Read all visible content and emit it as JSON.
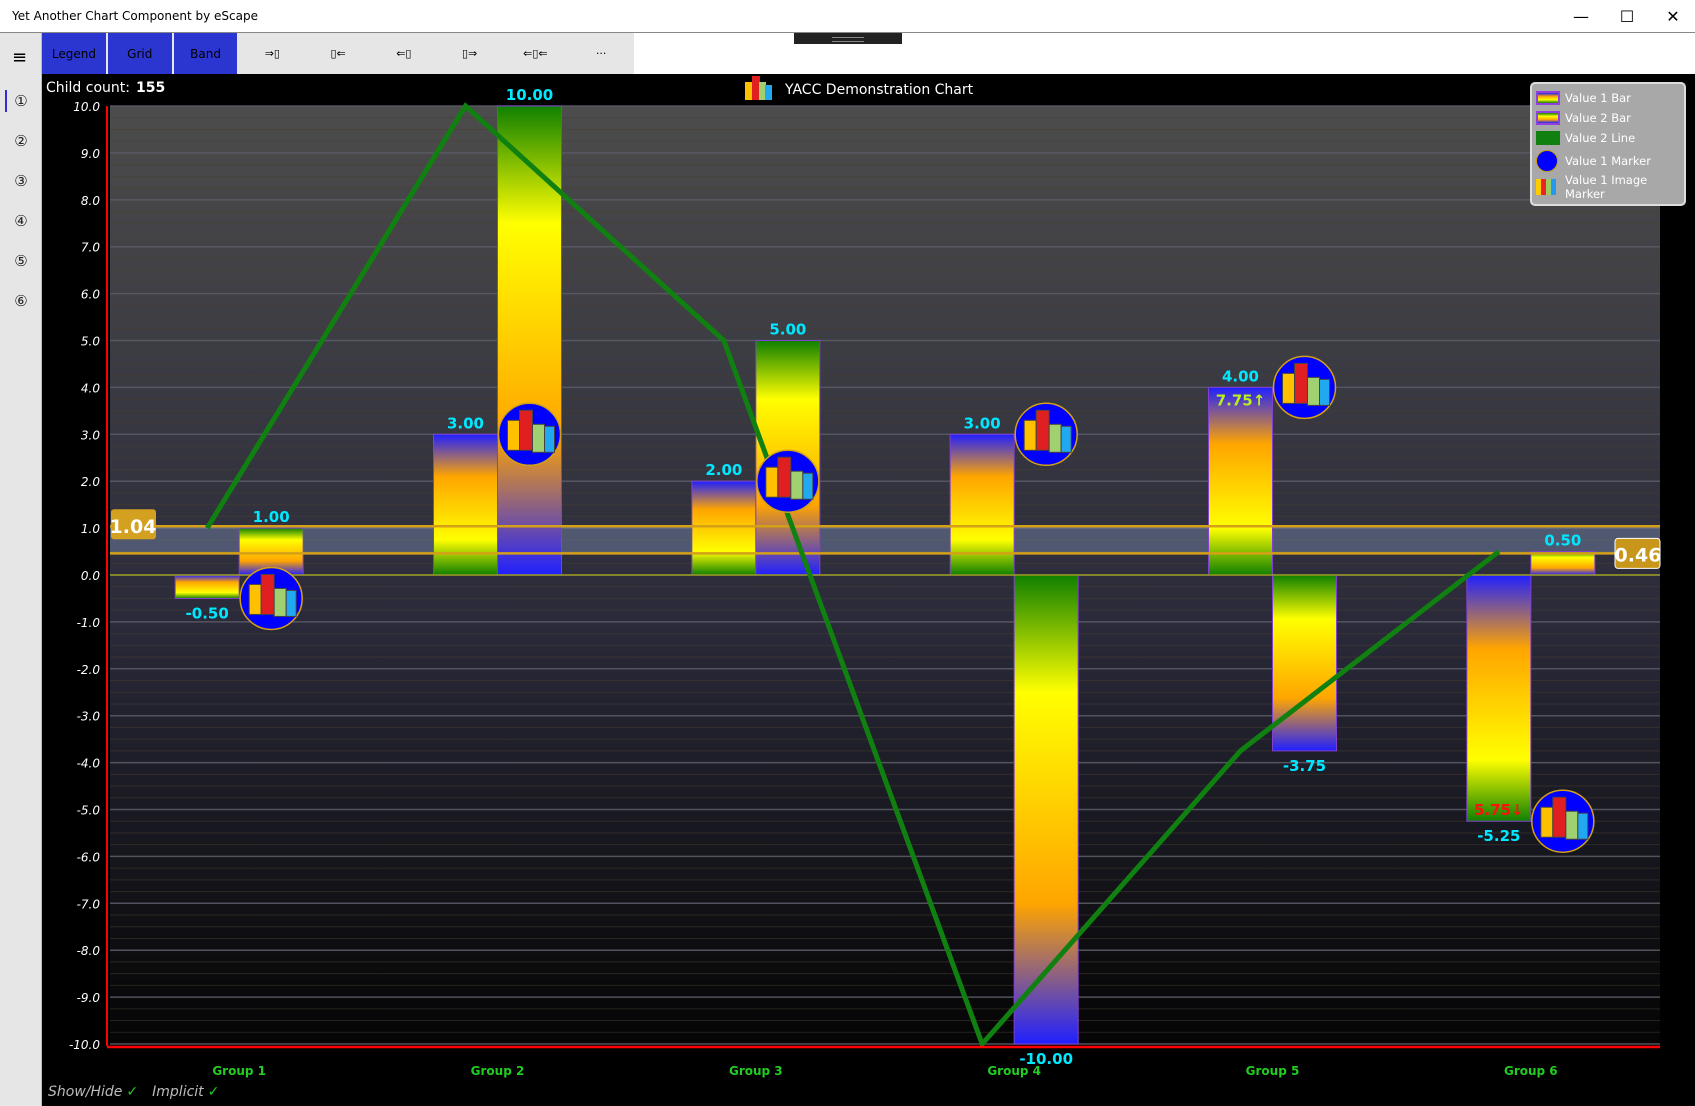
{
  "window": {
    "title": "Yet Another Chart Component by eScape",
    "minimize": "—",
    "maximize": "☐",
    "close": "✕"
  },
  "nav": {
    "menu_icon": "≡",
    "items": [
      "①",
      "②",
      "③",
      "④",
      "⑤",
      "⑥"
    ],
    "selected": 0
  },
  "toolbar": {
    "buttons": [
      {
        "label": "Legend",
        "active": true
      },
      {
        "label": "Grid",
        "active": true
      },
      {
        "label": "Band",
        "active": true
      },
      {
        "label": "⇒▯",
        "active": false
      },
      {
        "label": "▯⇐",
        "active": false
      },
      {
        "label": "⇐▯",
        "active": false
      },
      {
        "label": "▯⇒",
        "active": false
      },
      {
        "label": "⇐▯⇐",
        "active": false
      },
      {
        "label": "···",
        "active": false
      }
    ]
  },
  "status": {
    "child_count_label": "Child count:",
    "child_count": "155"
  },
  "footer": {
    "show_hide": "Show/Hide",
    "implicit": "Implicit",
    "check": "✓"
  },
  "legend": [
    {
      "label": "Value 1 Bar",
      "type": "bar1"
    },
    {
      "label": "Value 2 Bar",
      "type": "bar2"
    },
    {
      "label": "Value 2 Line",
      "type": "line"
    },
    {
      "label": "Value 1 Marker",
      "type": "marker"
    },
    {
      "label": "Value 1 Image Marker",
      "type": "image"
    }
  ],
  "colors": {
    "line": "#108010",
    "label": "#00e8ff",
    "band": "#d4a017",
    "axis": "#ff0000",
    "group_label": "#22cc22",
    "up_label": "#b8f020",
    "down_label": "#ff1010"
  },
  "chart_data": {
    "type": "bar",
    "title": "YACC Demonstration Chart",
    "categories": [
      "Group 1",
      "Group 2",
      "Group 3",
      "Group 4",
      "Group 5",
      "Group 6"
    ],
    "series": [
      {
        "name": "Value 1 Bar",
        "values": [
          -0.5,
          3,
          2,
          3,
          4,
          -5.25
        ],
        "labels": [
          "-0.50",
          "3.00",
          "2.00",
          "3.00",
          "4.00",
          "-5.25"
        ]
      },
      {
        "name": "Value 2 Bar",
        "values": [
          1,
          10,
          5,
          -10,
          -3.75,
          0.5
        ],
        "labels": [
          "1.00",
          "10.00",
          "5.00",
          "-10.00",
          "-3.75",
          "0.50"
        ]
      },
      {
        "name": "Value 2 Line",
        "type": "line",
        "values": [
          1,
          10,
          5,
          -10,
          -3.75,
          0.5
        ]
      },
      {
        "name": "Value 1 Image Marker",
        "type": "marker",
        "values": [
          -0.5,
          3,
          2,
          3,
          4,
          -5.25
        ]
      }
    ],
    "annotations": [
      {
        "group": 4,
        "text": "7.75↑",
        "kind": "up"
      },
      {
        "group": 5,
        "text": "5.75↓",
        "kind": "down"
      }
    ],
    "band": {
      "low": 0.46,
      "high": 1.04,
      "low_label": "0.46",
      "high_label": "1.04"
    },
    "ylim": [
      -10,
      10
    ],
    "yticks": [
      "10.0",
      "9.0",
      "8.0",
      "7.0",
      "6.0",
      "5.0",
      "4.0",
      "3.0",
      "2.0",
      "1.0",
      "0.0",
      "-1.0",
      "-2.0",
      "-3.0",
      "-4.0",
      "-5.0",
      "-6.0",
      "-7.0",
      "-8.0",
      "-9.0",
      "-10.0"
    ],
    "grid": true,
    "legend_position": "top-right"
  }
}
